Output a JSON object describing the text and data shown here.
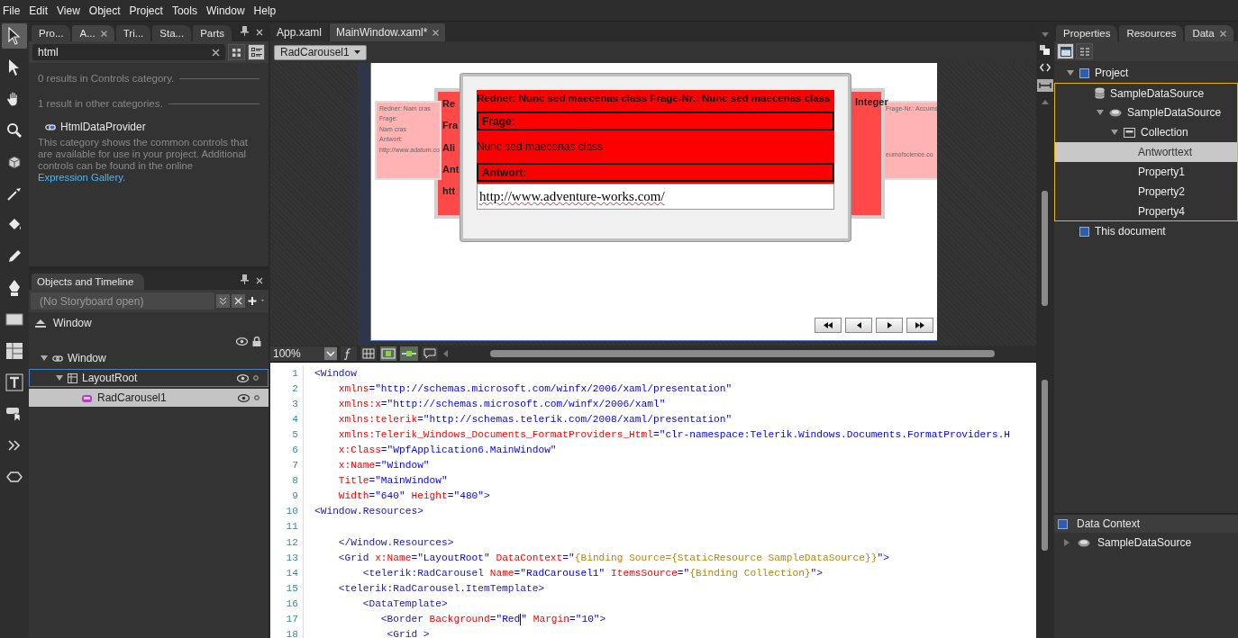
{
  "menu": [
    "File",
    "Edit",
    "View",
    "Object",
    "Project",
    "Tools",
    "Window",
    "Help"
  ],
  "toolbox": [
    {
      "kind": "select",
      "selected": true
    },
    {
      "kind": "direct",
      "selected": false
    },
    {
      "kind": "pan",
      "selected": false
    },
    {
      "kind": "zoom",
      "selected": false
    },
    {
      "kind": "orbit",
      "selected": false
    },
    {
      "kind": "eyedropper",
      "selected": false
    },
    {
      "kind": "bucket",
      "selected": false
    },
    {
      "kind": "pencil",
      "selected": false
    },
    {
      "kind": "pen",
      "selected": false
    },
    {
      "kind": "rectangle",
      "selected": false
    },
    {
      "kind": "grid",
      "selected": false
    },
    {
      "kind": "text",
      "selected": false
    },
    {
      "kind": "control",
      "selected": false
    },
    {
      "kind": "more",
      "selected": false
    },
    {
      "kind": "diamond",
      "selected": false
    }
  ],
  "assets_panel": {
    "tabs": [
      {
        "label": "Pro...",
        "selected": false
      },
      {
        "label": "A...",
        "selected": true
      },
      {
        "label": "Tri...",
        "selected": false
      },
      {
        "label": "Sta...",
        "selected": false
      },
      {
        "label": "Parts",
        "selected": false
      }
    ],
    "search": {
      "value": "html"
    },
    "view_modes": [
      {
        "kind": "grid",
        "selected": false
      },
      {
        "kind": "list",
        "selected": true
      }
    ],
    "sections": [
      "0 results in Controls category.",
      "1 result in other categories."
    ],
    "results": [
      "HtmlDataProvider"
    ],
    "description": "This category shows the common controls that are available for use in your project. Additional controls can be found in the online ",
    "link": "Expression Gallery",
    "description_end": "."
  },
  "objects_panel": {
    "title": "Objects and Timeline",
    "storyboard": {
      "placeholder": "(No Storyboard open)"
    },
    "scope": "Window",
    "tree": [
      {
        "label": "Window",
        "kind": "window",
        "expanded": true,
        "selected": false,
        "focused": false,
        "children": [
          {
            "label": "LayoutRoot",
            "kind": "grid",
            "expanded": true,
            "selected": false,
            "focused": true,
            "children": [
              {
                "label": "RadCarousel1",
                "kind": "control",
                "selected": true,
                "focused": false
              }
            ]
          }
        ]
      }
    ]
  },
  "documents": {
    "tabs": [
      {
        "label": "App.xaml",
        "selected": false
      },
      {
        "label": "MainWindow.xaml*",
        "selected": true
      }
    ],
    "breadcrumb": "RadCarousel1",
    "zoom": "100%"
  },
  "carousel": {
    "front": {
      "header": "Redner: Nunc sed maecenas class   Frage-Nr.: Nunc sed maecenas class",
      "question_label": "Frage:",
      "question": "Nunc sed maecenas class",
      "answer_label": "Antwort:",
      "answer": "http://www.adventure-works.com/"
    },
    "back_cards": [
      {
        "kind": "far-left",
        "texts": [
          "Redner: Nam cras",
          "Frage:",
          "Nam cras",
          "Antwort:",
          "http://www.adatum.co"
        ]
      },
      {
        "kind": "far-right",
        "texts": [
          "Frage-Nr.: Accums",
          "eumofscience.co"
        ]
      },
      {
        "kind": "mid-left",
        "texts": [
          "Re",
          "Fra",
          "Ali",
          "Ant",
          "htt"
        ]
      },
      {
        "kind": "mid-right",
        "texts": [
          "Integer"
        ]
      }
    ],
    "nav_buttons": [
      {
        "kind": "first"
      },
      {
        "kind": "prev"
      },
      {
        "kind": "next"
      },
      {
        "kind": "last"
      }
    ]
  },
  "code": {
    "lines": [
      {
        "number": "1",
        "tokens": [
          {
            "kind": "tag",
            "text": "<Window"
          }
        ]
      },
      {
        "number": "2",
        "tokens": [
          {
            "kind": "attr",
            "text": "    xmlns"
          },
          {
            "kind": "value",
            "text": "=\"http://schemas.microsoft.com/winfx/2006/xaml/presentation\""
          }
        ]
      },
      {
        "number": "3",
        "tokens": [
          {
            "kind": "attr",
            "text": "    xmlns:x"
          },
          {
            "kind": "value",
            "text": "=\"http://schemas.microsoft.com/winfx/2006/xaml\""
          }
        ]
      },
      {
        "number": "4",
        "tokens": [
          {
            "kind": "attr",
            "text": "    xmlns:telerik"
          },
          {
            "kind": "value",
            "text": "=\"http://schemas.telerik.com/2008/xaml/presentation\""
          }
        ]
      },
      {
        "number": "5",
        "tokens": [
          {
            "kind": "attr",
            "text": "    xmlns:Telerik_Windows_Documents_FormatProviders_Html"
          },
          {
            "kind": "value",
            "text": "=\"clr-namespace:Telerik.Windows.Documents.FormatProviders.H"
          }
        ]
      },
      {
        "number": "6",
        "tokens": [
          {
            "kind": "attr",
            "text": "    x:Class"
          },
          {
            "kind": "value",
            "text": "=\"WpfApplication6.MainWindow\""
          }
        ]
      },
      {
        "number": "7",
        "tokens": [
          {
            "kind": "attr",
            "text": "    x:Name"
          },
          {
            "kind": "value",
            "text": "=\"Window\""
          }
        ]
      },
      {
        "number": "8",
        "tokens": [
          {
            "kind": "attr",
            "text": "    Title"
          },
          {
            "kind": "value",
            "text": "=\"MainWindow\""
          }
        ]
      },
      {
        "number": "9",
        "tokens": [
          {
            "kind": "attr",
            "text": "    Width"
          },
          {
            "kind": "value",
            "text": "=\"640\""
          },
          {
            "kind": "attr",
            "text": " Height"
          },
          {
            "kind": "value",
            "text": "=\"480\""
          },
          {
            "kind": "tag",
            "text": ">"
          }
        ]
      },
      {
        "number": "10",
        "tokens": [
          {
            "kind": "tag",
            "text": "<Window.Resources>"
          }
        ]
      },
      {
        "number": "11"
      },
      {
        "number": "12",
        "tokens": [
          {
            "kind": "tag",
            "text": "    </Window.Resources>"
          }
        ]
      },
      {
        "number": "13",
        "tokens": [
          {
            "kind": "tag",
            "text": "    <Grid"
          },
          {
            "kind": "attr",
            "text": " x:Name"
          },
          {
            "kind": "value",
            "text": "=\"LayoutRoot\""
          },
          {
            "kind": "attr",
            "text": " DataContext"
          },
          {
            "kind": "value",
            "text": "=\""
          },
          {
            "kind": "binding",
            "text": "{Binding Source={StaticResource SampleDataSource}}"
          },
          {
            "kind": "value",
            "text": "\""
          },
          {
            "kind": "tag",
            "text": ">"
          }
        ]
      },
      {
        "number": "14",
        "tokens": [
          {
            "kind": "tag",
            "text": "        <telerik:RadCarousel"
          },
          {
            "kind": "attr",
            "text": " Name"
          },
          {
            "kind": "value",
            "text": "=\"RadCarousel1\""
          },
          {
            "kind": "attr",
            "text": " ItemsSource"
          },
          {
            "kind": "value",
            "text": "=\""
          },
          {
            "kind": "binding",
            "text": "{Binding Collection}"
          },
          {
            "kind": "value",
            "text": "\""
          },
          {
            "kind": "tag",
            "text": ">"
          }
        ]
      },
      {
        "number": "15",
        "tokens": [
          {
            "kind": "tag",
            "text": "    <telerik:RadCarousel.ItemTemplate>"
          }
        ]
      },
      {
        "number": "16",
        "tokens": [
          {
            "kind": "tag",
            "text": "        <DataTemplate>"
          }
        ]
      },
      {
        "number": "17",
        "tokens": [
          {
            "kind": "tag",
            "text": "           <Border"
          },
          {
            "kind": "attr",
            "text": " Background"
          },
          {
            "kind": "value",
            "text": "=\"Red"
          },
          {
            "kind": "caret"
          },
          {
            "kind": "value",
            "text": "\""
          },
          {
            "kind": "attr",
            "text": " Margin"
          },
          {
            "kind": "value",
            "text": "=\"10\""
          },
          {
            "kind": "tag",
            "text": ">"
          }
        ]
      },
      {
        "number": "18",
        "tokens": [
          {
            "kind": "tag",
            "text": "            <Grid >"
          }
        ]
      }
    ]
  },
  "data_panel": {
    "tabs": [
      {
        "label": "Properties",
        "selected": false
      },
      {
        "label": "Resources",
        "selected": false
      },
      {
        "label": "Data",
        "selected": true
      }
    ],
    "view_modes": [
      {
        "kind": "list",
        "selected": true
      },
      {
        "kind": "details",
        "selected": false
      }
    ],
    "tree": [
      {
        "label": "Project",
        "expanded": true,
        "selected": false,
        "highlighted": false,
        "children": [
          {
            "label": "SampleDataSource",
            "kind": "database",
            "expanded": true,
            "selected": false,
            "highlighted": true,
            "children": [
              {
                "label": "SampleDataSource",
                "kind": "object",
                "expanded": true,
                "selected": false,
                "highlighted": false,
                "children": [
                  {
                    "label": "Collection",
                    "kind": "collection",
                    "expanded": true,
                    "selected": false,
                    "highlighted": false,
                    "children": [
                      {
                        "label": "Antworttext",
                        "selected": true,
                        "highlighted": false
                      },
                      {
                        "label": "Property1",
                        "selected": false,
                        "highlighted": false
                      },
                      {
                        "label": "Property2",
                        "selected": false,
                        "highlighted": false
                      },
                      {
                        "label": "Property4",
                        "selected": false,
                        "highlighted": false
                      }
                    ]
                  }
                ]
              }
            ]
          }
        ]
      },
      {
        "label": "This document",
        "selected": false,
        "highlighted": false
      }
    ],
    "data_context": {
      "title": "Data Context",
      "tree": [
        {
          "label": "SampleDataSource",
          "kind": "object",
          "expanded": false,
          "selected": false,
          "highlighted": false
        }
      ]
    }
  }
}
